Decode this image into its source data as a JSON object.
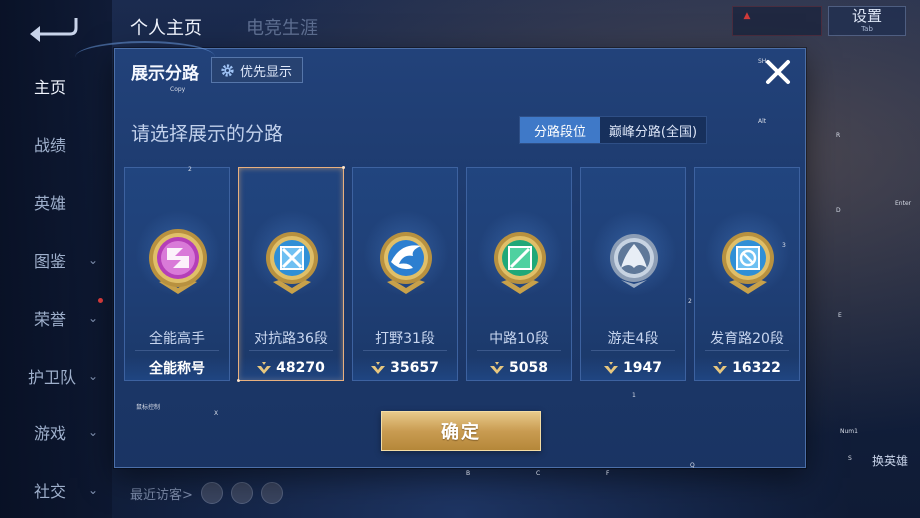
{
  "header": {
    "tabs": [
      {
        "label": "个人主页"
      },
      {
        "label": "电竞生涯"
      }
    ],
    "settings_label": "设置",
    "settings_sub": "Tab"
  },
  "sidebar": {
    "items": [
      {
        "label": "主页"
      },
      {
        "label": "战绩"
      },
      {
        "label": "英雄"
      },
      {
        "label": "图鉴"
      },
      {
        "label": "荣誉"
      },
      {
        "label": "护卫队"
      },
      {
        "label": "游戏"
      },
      {
        "label": "社交"
      }
    ]
  },
  "footer": {
    "recent_label": "最近访客>",
    "hero_switch": "换英雄"
  },
  "modal": {
    "title": "展示分路",
    "priority_label": "优先显示",
    "prompt": "请选择展示的分路",
    "segment": {
      "options": [
        "分路段位",
        "巅峰分路(全国)"
      ],
      "selected": "分路段位"
    },
    "confirm_label": "确定",
    "cards": [
      {
        "name": "全能高手",
        "score": "全能称号",
        "emblem": "allround-emblem-icon",
        "color": "#b53fb8"
      },
      {
        "name": "对抗路36段",
        "score": "48270",
        "emblem": "clash-lane-emblem-icon",
        "color": "#2f8fd6",
        "selected": true
      },
      {
        "name": "打野31段",
        "score": "35657",
        "emblem": "jungle-emblem-icon",
        "color": "#2c7fd0"
      },
      {
        "name": "中路10段",
        "score": "5058",
        "emblem": "mid-lane-emblem-icon",
        "color": "#1fa878"
      },
      {
        "name": "游走4段",
        "score": "1947",
        "emblem": "roam-emblem-icon",
        "color": "#7f98b8"
      },
      {
        "name": "发育路20段",
        "score": "16322",
        "emblem": "farm-lane-emblem-icon",
        "color": "#2f8fd6"
      }
    ]
  },
  "overlay_hints": {
    "copy": "Copy",
    "sh": "SH",
    "alt": "Alt",
    "r": "R",
    "d": "D",
    "enter": "Enter",
    "e": "E",
    "num1": "Num1",
    "s": "S",
    "x": "X",
    "b": "B",
    "c": "C",
    "f": "F",
    "q": "Q",
    "one": "1",
    "two_a": "2",
    "two_b": "2",
    "three": "3",
    "mouse": "鼠标控制"
  },
  "colors": {
    "accent": "#3f79c8",
    "gold": "#c99c52",
    "selected_border": "#e9b07e"
  }
}
